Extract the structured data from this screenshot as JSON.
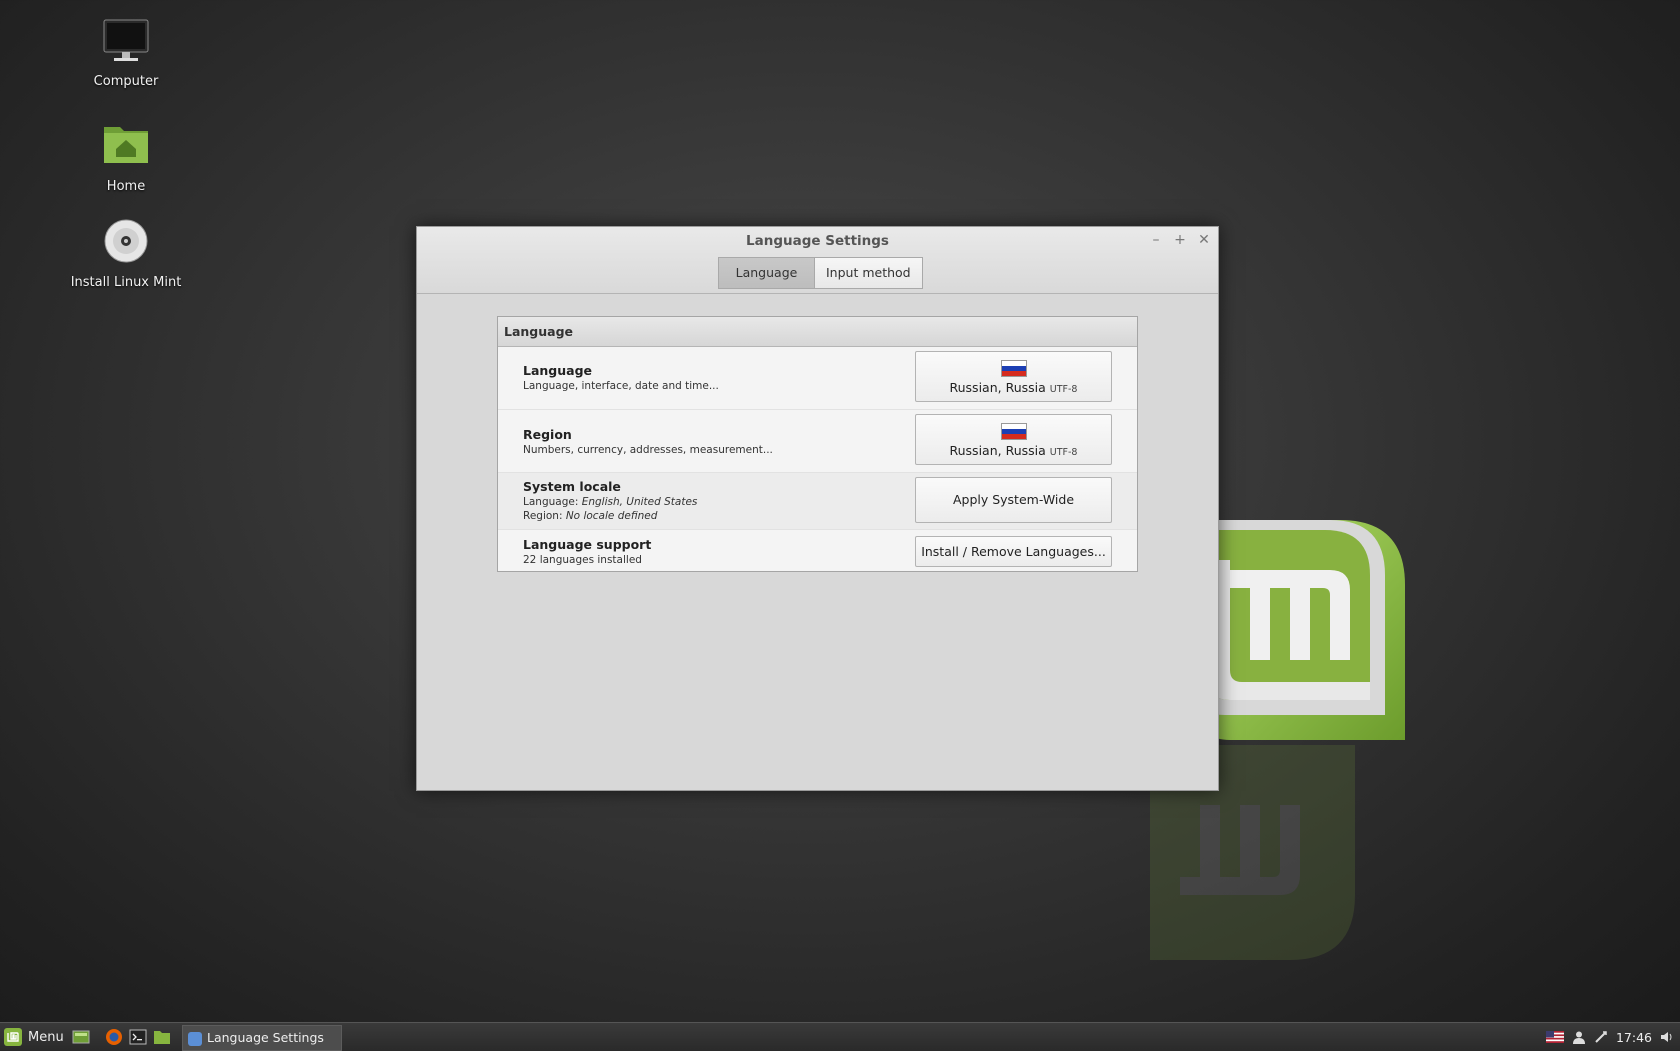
{
  "desktop": {
    "icons": [
      {
        "label": "Computer"
      },
      {
        "label": "Home"
      },
      {
        "label": "Install Linux Mint"
      }
    ]
  },
  "window": {
    "title": "Language Settings",
    "controls": {
      "minimize": "–",
      "maximize": "+",
      "close": "✕"
    },
    "tabs": [
      {
        "label": "Language",
        "active": true
      },
      {
        "label": "Input method",
        "active": false
      }
    ],
    "section": {
      "title": "Language",
      "rows": [
        {
          "title": "Language",
          "subtitle": "Language, interface, date and time...",
          "button_label": "Russian, Russia",
          "button_encoding": "UTF-8",
          "flag": "ru"
        },
        {
          "title": "Region",
          "subtitle": "Numbers, currency, addresses, measurement...",
          "button_label": "Russian, Russia",
          "button_encoding": "UTF-8",
          "flag": "ru"
        },
        {
          "title": "System locale",
          "line1_prefix": "Language: ",
          "line1_value": "English, United States",
          "line2_prefix": "Region: ",
          "line2_value": "No locale defined",
          "button_label": "Apply System-Wide"
        },
        {
          "title": "Language support",
          "subtitle": "22 languages installed",
          "button_label": "Install / Remove Languages..."
        }
      ]
    }
  },
  "taskbar": {
    "menu_label": "Menu",
    "launchers": [
      "show-desktop-icon",
      "firefox-icon",
      "terminal-icon",
      "files-icon"
    ],
    "tasks": [
      {
        "label": "Language Settings"
      }
    ],
    "clock": "17:46",
    "tray": [
      "us-flag-icon",
      "user-icon",
      "network-icon",
      "volume-icon"
    ]
  },
  "colors": {
    "mint_green": "#87b53f",
    "mint_dark": "#5e8a2a"
  }
}
